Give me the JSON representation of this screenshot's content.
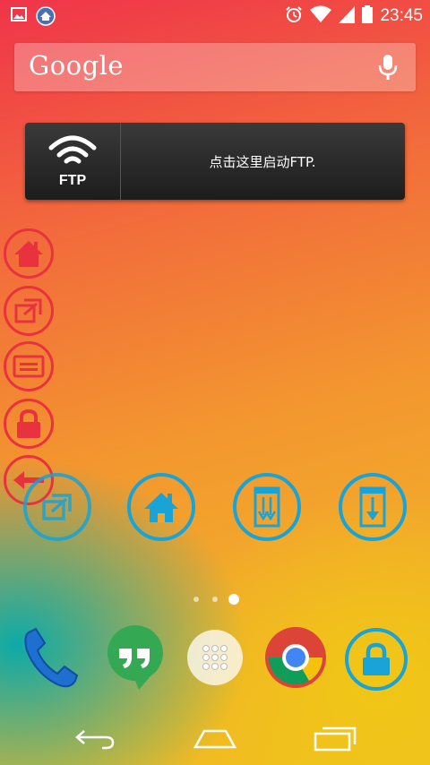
{
  "status_bar": {
    "time": "23:45",
    "left_icons": [
      "image-icon",
      "app-notification-icon"
    ],
    "right_icons": [
      "alarm-icon",
      "wifi-icon",
      "signal-icon",
      "battery-icon"
    ]
  },
  "search": {
    "logo_text": "Google",
    "mic_icon": "mic-icon"
  },
  "ftp_widget": {
    "label": "FTP",
    "text": "点击这里启动FTP."
  },
  "floating_menu": [
    {
      "name": "home",
      "icon": "home-icon"
    },
    {
      "name": "recent-apps",
      "icon": "window-icon"
    },
    {
      "name": "menu",
      "icon": "menu-icon"
    },
    {
      "name": "lock",
      "icon": "lock-icon"
    },
    {
      "name": "back",
      "icon": "back-arrow-icon"
    }
  ],
  "home_apps": [
    {
      "name": "window-switch",
      "icon": "window-icon"
    },
    {
      "name": "home",
      "icon": "home-icon"
    },
    {
      "name": "scroll-down-double",
      "icon": "double-arrow-down-icon"
    },
    {
      "name": "scroll-down",
      "icon": "arrow-down-icon"
    }
  ],
  "page_indicator": {
    "pages": 3,
    "current": 3
  },
  "dock": [
    {
      "name": "phone",
      "icon": "phone-icon"
    },
    {
      "name": "hangouts",
      "icon": "quote-icon"
    },
    {
      "name": "app-drawer",
      "icon": "grid-icon"
    },
    {
      "name": "chrome",
      "icon": "chrome-icon"
    },
    {
      "name": "screen-lock",
      "icon": "lock-icon"
    }
  ],
  "nav_bar": [
    "back-icon",
    "home-icon",
    "recent-apps-icon"
  ],
  "colors": {
    "accent_red": "#e8333f",
    "accent_blue": "#1aa3d6"
  }
}
